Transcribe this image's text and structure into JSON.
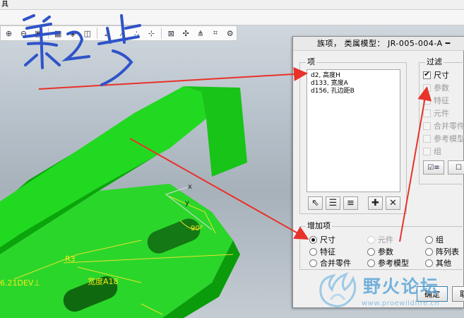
{
  "menubar": {
    "text": "具"
  },
  "dialog": {
    "title": "族项，  类属模型： JR-005-004-A  ━",
    "items_group": {
      "label": "项",
      "rows": [
        "d2, 高度H",
        "d133, 宽度A",
        "d156, 孔边距B"
      ]
    },
    "filter_group": {
      "label": "过滤",
      "items": [
        {
          "label": "尺寸",
          "checked": true,
          "enabled": true
        },
        {
          "label": "参数",
          "checked": false,
          "enabled": false
        },
        {
          "label": "特征",
          "checked": false,
          "enabled": false
        },
        {
          "label": "元件",
          "checked": false,
          "enabled": false
        },
        {
          "label": "合并零件",
          "checked": false,
          "enabled": false
        },
        {
          "label": "参考模型",
          "checked": false,
          "enabled": false
        },
        {
          "label": "组",
          "checked": false,
          "enabled": false
        }
      ]
    },
    "add_group": {
      "label": "增加项",
      "options": [
        {
          "label": "尺寸",
          "selected": true,
          "enabled": true
        },
        {
          "label": "元件",
          "selected": false,
          "enabled": false
        },
        {
          "label": "组",
          "selected": false,
          "enabled": true
        },
        {
          "label": "特征",
          "selected": false,
          "enabled": true
        },
        {
          "label": "参数",
          "selected": false,
          "enabled": true
        },
        {
          "label": "阵列表",
          "selected": false,
          "enabled": true
        },
        {
          "label": "合并零件",
          "selected": false,
          "enabled": true
        },
        {
          "label": "参考模型",
          "selected": false,
          "enabled": true
        },
        {
          "label": "其他",
          "selected": false,
          "enabled": true
        }
      ]
    },
    "buttons": {
      "ok": "确定",
      "cancel": "取消"
    }
  },
  "annotation": {
    "handwritten": "第2步"
  },
  "model_labels": {
    "dim_left": "6.21DEV⊥",
    "r3": "R3",
    "width_a": "宽度A18",
    "x": "x",
    "y": "y",
    "deg": "90°"
  },
  "watermark": {
    "text": "野火论坛",
    "url": "www.proewildfire.cn"
  },
  "colors": {
    "part_green": "#1fd51f",
    "arrow_red": "#e8322a",
    "ink_blue": "#2f53c8"
  }
}
